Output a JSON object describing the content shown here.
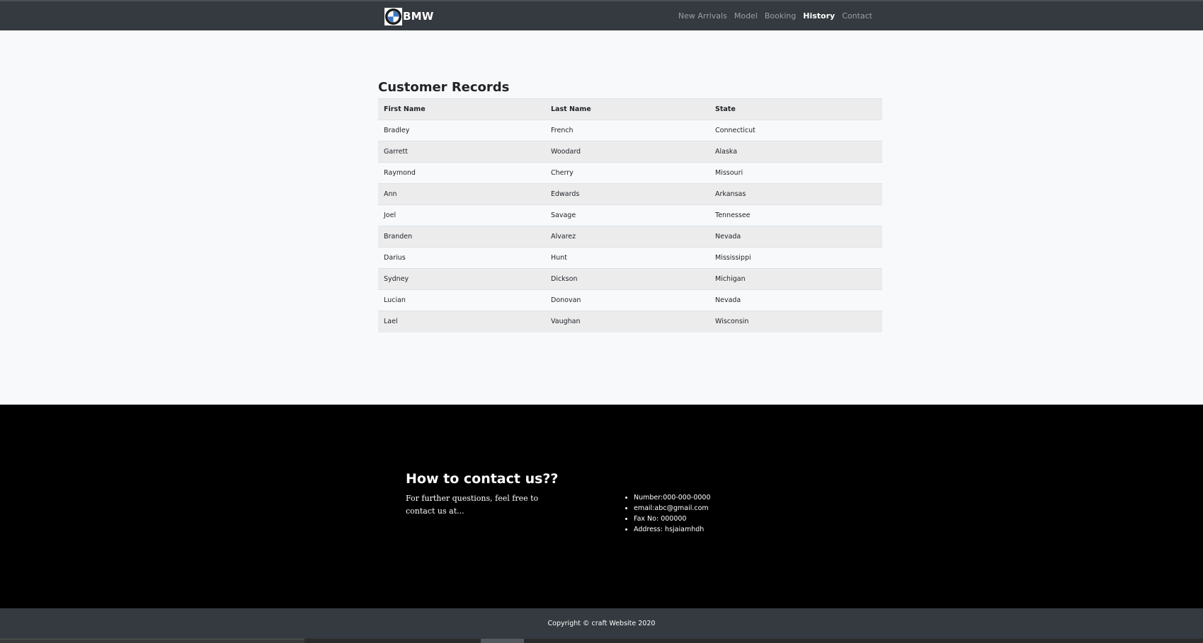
{
  "brand": {
    "name": "BMW",
    "logo_icon": "bmw-roundel-icon"
  },
  "nav": {
    "items": [
      {
        "label": "New Arrivals",
        "active": false
      },
      {
        "label": "Model",
        "active": false
      },
      {
        "label": "Booking",
        "active": false
      },
      {
        "label": "History",
        "active": true
      },
      {
        "label": "Contact",
        "active": false
      }
    ]
  },
  "records": {
    "title": "Customer Records",
    "columns": [
      "First Name",
      "Last Name",
      "State"
    ],
    "rows": [
      [
        "Bradley",
        "French",
        "Connecticut"
      ],
      [
        "Garrett",
        "Woodard",
        "Alaska"
      ],
      [
        "Raymond",
        "Cherry",
        "Missouri"
      ],
      [
        "Ann",
        "Edwards",
        "Arkansas"
      ],
      [
        "Joel",
        "Savage",
        "Tennessee"
      ],
      [
        "Branden",
        "Alvarez",
        "Nevada"
      ],
      [
        "Darius",
        "Hunt",
        "Mississippi"
      ],
      [
        "Sydney",
        "Dickson",
        "Michigan"
      ],
      [
        "Lucian",
        "Donovan",
        "Nevada"
      ],
      [
        "Lael",
        "Vaughan",
        "Wisconsin"
      ]
    ]
  },
  "contact": {
    "heading": "How to contact us??",
    "text": "For further questions, feel free to contact us at...",
    "details": [
      "Number:000-000-0000",
      "email:abc@gmail.com",
      "Fax No: 000000",
      "Address: hsjaiamhdh"
    ]
  },
  "footer": {
    "copyright": "Copyright © craft Website 2020"
  },
  "colors": {
    "navbar": "#343a40",
    "page_background": "#f8f9fa",
    "footer_background": "#000000",
    "striped_row": "#ececed"
  }
}
